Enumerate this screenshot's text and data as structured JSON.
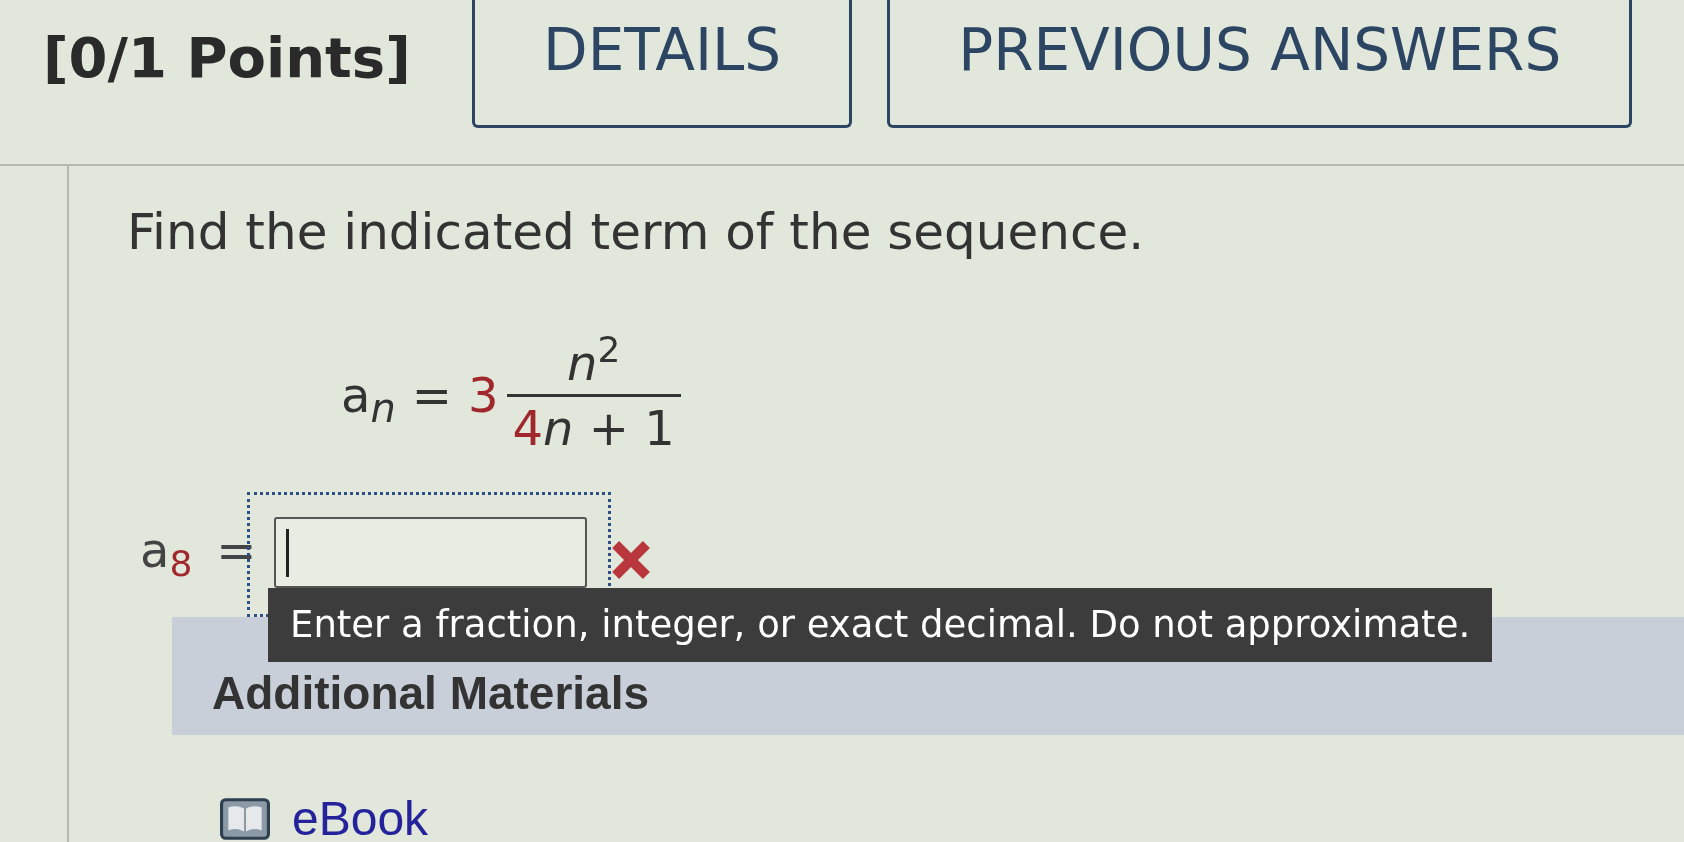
{
  "header": {
    "score": "[0/1 Points]",
    "buttons": [
      {
        "label": "DETAILS"
      },
      {
        "label": "PREVIOUS ANSWERS"
      }
    ]
  },
  "question": {
    "prompt": "Find the indicated term of the sequence.",
    "formula": {
      "lhs": "a$_{n}$",
      "equals": "=",
      "coefficient": {
        "text": "3",
        "highlighted": true
      },
      "numerator": "*n*$^{2}$",
      "denominator": [
        {
          "text": "4",
          "highlighted": true
        },
        {
          "text": "*n* + 1",
          "highlighted": false
        }
      ]
    },
    "answer": {
      "label": "a",
      "index": {
        "text": "8",
        "highlighted": true
      },
      "equals": "=",
      "focused": true,
      "correct": false,
      "hint": "Enter a fraction, integer, or exact decimal. Do not approximate."
    }
  },
  "additional_materials": {
    "title": "Additional Materials",
    "links": [
      {
        "label": "eBook"
      }
    ]
  }
}
